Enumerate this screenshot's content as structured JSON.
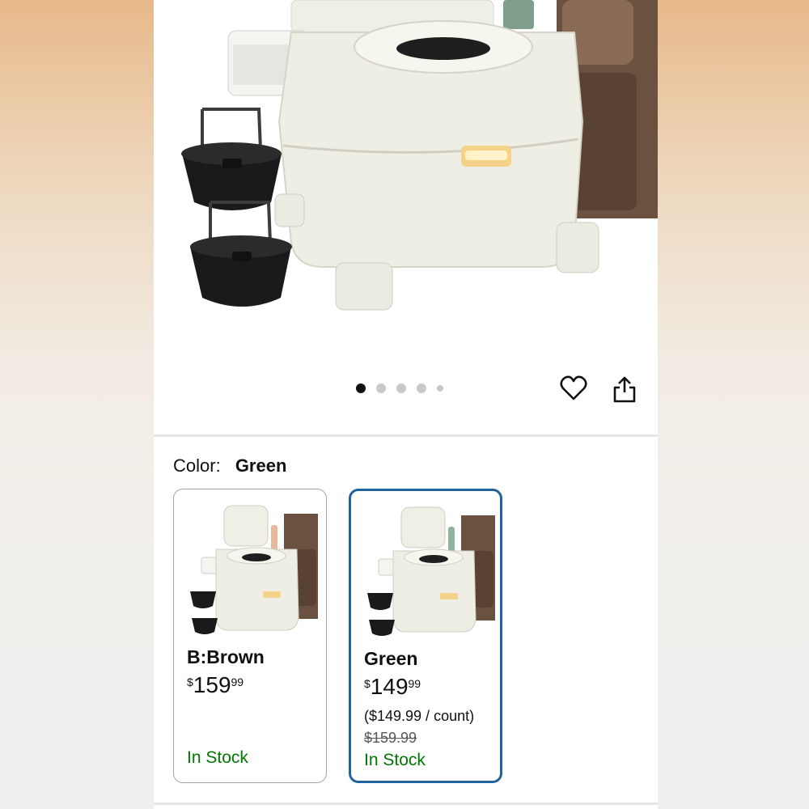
{
  "gallery": {
    "image_alt": "Portable commode toilet with two black buckets",
    "dot_count": 5,
    "active_index": 0
  },
  "actions": {
    "favorite_icon": "heart-icon",
    "share_icon": "share-icon"
  },
  "color_selector": {
    "label": "Color:",
    "selected": "Green"
  },
  "variants": [
    {
      "name": "B:Brown",
      "currency": "$",
      "price_whole": "159",
      "price_fraction": "99",
      "stock": "In Stock",
      "accent": "#e8b89a",
      "selected": false
    },
    {
      "name": "Green",
      "currency": "$",
      "price_whole": "149",
      "price_fraction": "99",
      "unit_price": "($149.99 / count)",
      "list_price": "$159.99",
      "stock": "In Stock",
      "accent": "#8fb5a0",
      "selected": true
    }
  ],
  "colors": {
    "selected_border": "#2162a1",
    "in_stock": "#007600",
    "border": "#a2a6ac"
  }
}
